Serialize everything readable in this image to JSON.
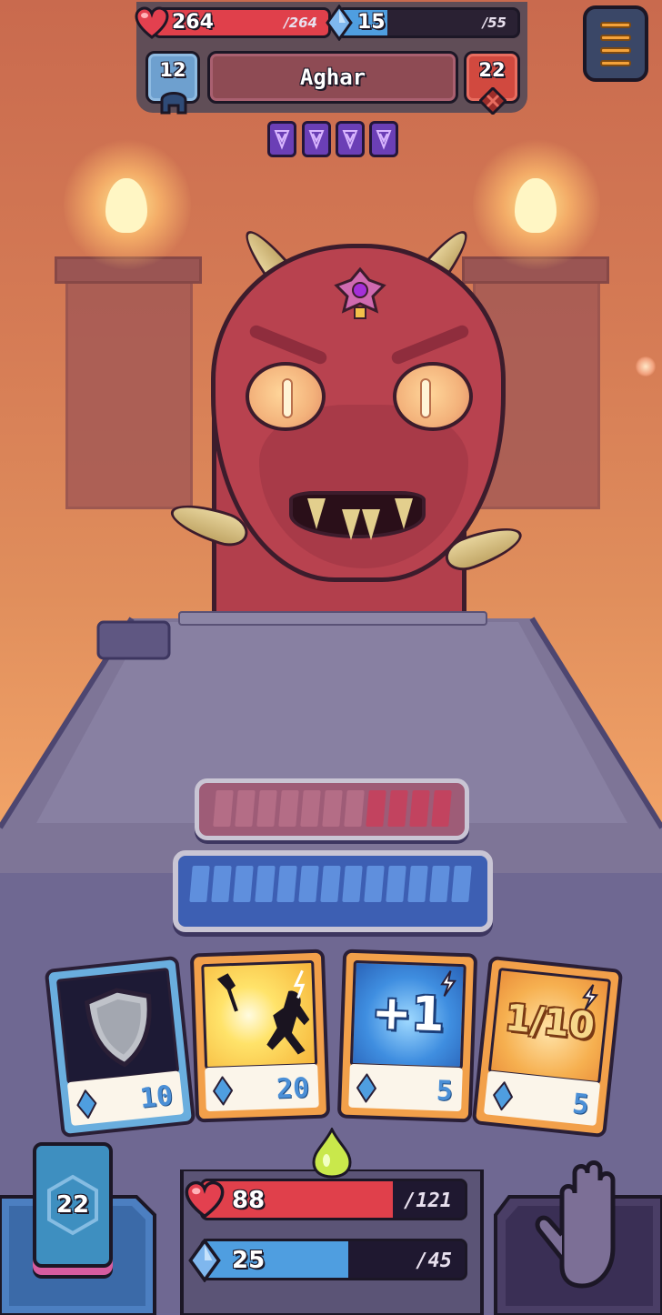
{
  "enemy": {
    "name": "Aghar",
    "hp": "264",
    "hp_max": "/264",
    "hp_fraction": 1.0,
    "mana": "15",
    "mana_max": "/55",
    "mana_fraction": 0.27,
    "armor": "12",
    "attack": "22",
    "intents": [
      "curse-icon",
      "curse-icon",
      "curse-icon",
      "curse-icon"
    ]
  },
  "cards": [
    {
      "name": "shield-card",
      "cost": "10",
      "art": "shield-icon"
    },
    {
      "name": "axe-knockback-card",
      "cost": "20",
      "art": "axe-hit-icon"
    },
    {
      "name": "plus-one-card",
      "art_text": "+1",
      "cost": "5"
    },
    {
      "name": "one-tenth-card",
      "art_text": "1/10",
      "cost": "5"
    }
  ],
  "player": {
    "deck_count": "22",
    "hp": "88",
    "hp_max": "/121",
    "hp_fraction": 0.727,
    "mana": "25",
    "mana_max": "/45",
    "mana_fraction": 0.556
  },
  "colors": {
    "hp_red": "#e0404b",
    "mana_blue": "#4f9ee0",
    "enemy_slot": "#c35b73",
    "player_slot": "#4a74c9"
  }
}
